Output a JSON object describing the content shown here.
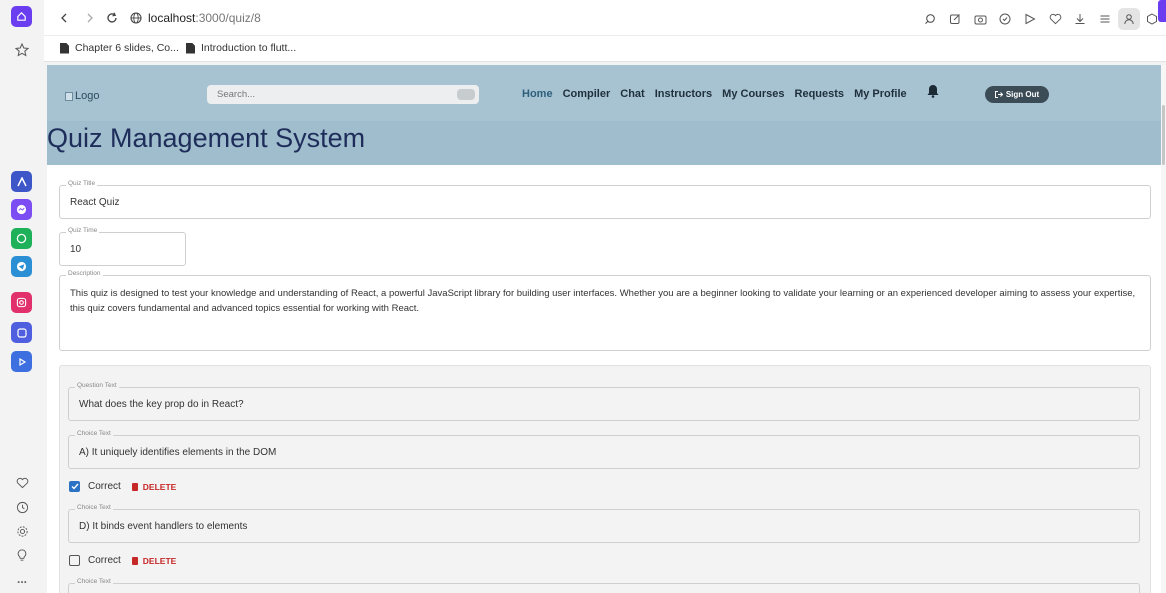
{
  "browser": {
    "url_host": "localhost",
    "url_path": ":3000/quiz/8",
    "bookmarks": [
      "Chapter 6 slides, Co...",
      "Introduction to flutt..."
    ],
    "sidebar_more": "..."
  },
  "header": {
    "logo_alt": "Logo",
    "search_placeholder": "Search...",
    "nav": [
      "Home",
      "Compiler",
      "Chat",
      "Instructors",
      "My Courses",
      "Requests",
      "My Profile"
    ],
    "sign_out": "Sign Out",
    "page_title": "Quiz Management System"
  },
  "quiz": {
    "title_label": "Quiz Title",
    "title_value": "React Quiz",
    "time_label": "Quiz Time",
    "time_value": "10",
    "desc_label": "Description",
    "desc_value": "This quiz is designed to test your knowledge and understanding of React, a powerful JavaScript library for building user interfaces. Whether you are a beginner looking to validate your learning or an experienced developer aiming to assess your expertise, this quiz covers fundamental and advanced topics essential for working with React."
  },
  "question": {
    "text_label": "Question Text",
    "text_value": "What does the key prop do in React?",
    "choice_label": "Choice Text",
    "correct_label": "Correct",
    "delete_label": "DELETE",
    "choices": [
      {
        "text": "A) It uniquely identifies elements in the DOM",
        "correct": true
      },
      {
        "text": "D) It binds event handlers to elements",
        "correct": false
      },
      {
        "text": "",
        "correct": false
      }
    ]
  },
  "colors": {
    "header_bg": "#a7c3d1",
    "title_band": "#9fbdcd",
    "accent_blue": "#2a72c4",
    "delete_red": "#c62828"
  }
}
